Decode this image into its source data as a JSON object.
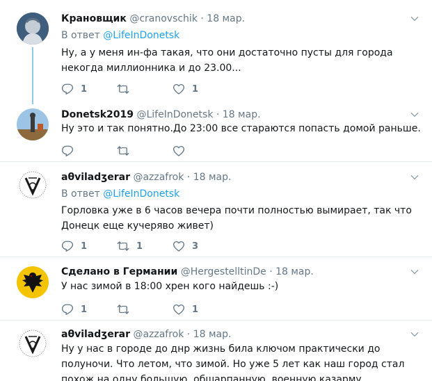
{
  "tweets": [
    {
      "name": "Крановщик",
      "handle": "@cranovschik",
      "dot": "·",
      "time": "18 мар.",
      "reply_prefix": "В ответ",
      "reply_to": "@LifeInDonetsk",
      "text": "Ну, а у меня ин-фа такая, что они достаточно пусты для города некогда миллионника и до 23.00...",
      "replies": "1",
      "retweets": "",
      "likes": "1"
    },
    {
      "name": "Donetsk2019",
      "handle": "@LifeInDonetsk",
      "dot": "·",
      "time": "18 мар.",
      "text": "Ну это и так понятно.До 23:00 все стараются попасть домой раньше.",
      "replies": "",
      "retweets": "",
      "likes": ""
    },
    {
      "name": "aθviladʒerar",
      "handle": "@azzafrok",
      "dot": "·",
      "time": "18 мар.",
      "reply_prefix": "В ответ",
      "reply_to": "@LifeInDonetsk",
      "text": "Горловка уже в 6 часов вечера почти полностью вымирает, так что Донецк еще кучеряво живет)",
      "replies": "1",
      "retweets": "1",
      "likes": "3"
    },
    {
      "name": "Сделано в Германии",
      "handle": "@HergestelltinDe",
      "dot": "·",
      "time": "18 мар.",
      "text": "У нас зимой в 18:00 хрен кого найдешь :-)",
      "replies": "1",
      "retweets": "",
      "likes": "1"
    },
    {
      "name": "aθviladʒerar",
      "handle": "@azzafrok",
      "dot": "·",
      "time": "18 мар.",
      "text": "Ну у нас в городе до днр жизнь била ключом практически до полуночи. Что летом, что зимой. Но уже 5 лет как наш город стал похож на одну большую, обшарпанную, военную казарму."
    }
  ],
  "icons": {
    "reply": "reply-icon",
    "retweet": "retweet-icon",
    "like": "like-icon",
    "caret": "chevron-down-icon"
  },
  "colors": {
    "link": "#1da1f2",
    "muted": "#657786",
    "thread": "#8ec8ed",
    "divider": "#e6ecf0"
  }
}
